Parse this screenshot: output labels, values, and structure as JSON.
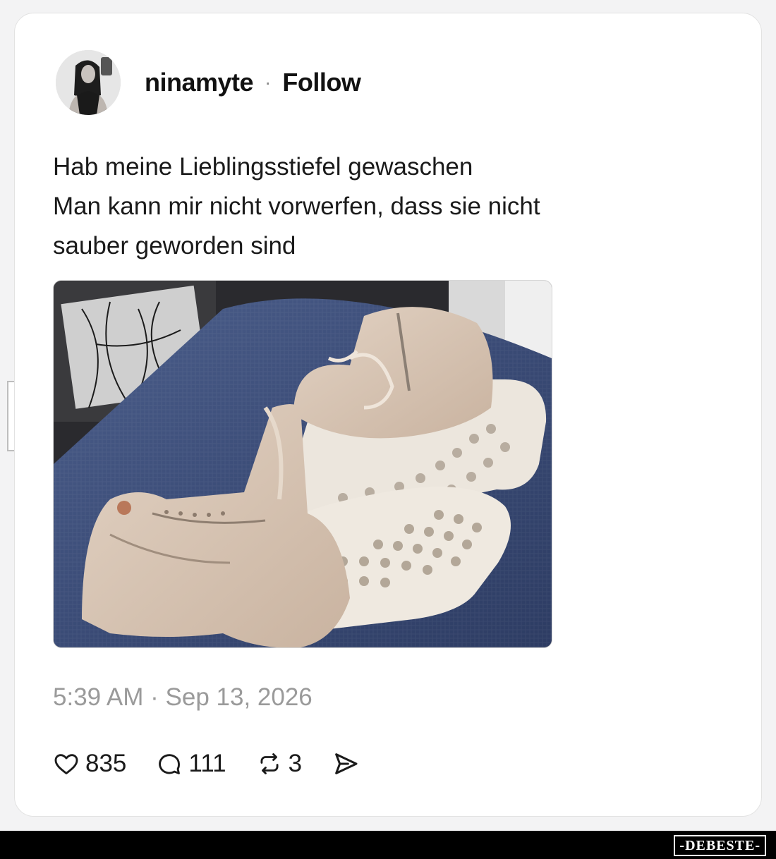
{
  "post": {
    "username": "ninamyte",
    "separator": "·",
    "follow_label": "Follow",
    "text_lines": [
      "Hab meine Lieblingsstiefel gewaschen",
      "Man kann mir nicht vorwerfen, dass sie nicht",
      "sauber geworden sind"
    ],
    "timestamp": "5:39 AM · Sep 13, 2026",
    "likes": "835",
    "comments": "111",
    "reposts": "3"
  },
  "icons": {
    "like": "heart-icon",
    "comment": "speech-bubble-icon",
    "repost": "repost-arrows-icon",
    "share": "send-icon"
  },
  "watermark": {
    "side": "DEBESTE",
    "footer": "-DEBESTE-"
  },
  "colors": {
    "card_bg": "#ffffff",
    "page_bg": "#f3f3f4",
    "text": "#1a1a1a",
    "muted": "#9a9a9a"
  }
}
